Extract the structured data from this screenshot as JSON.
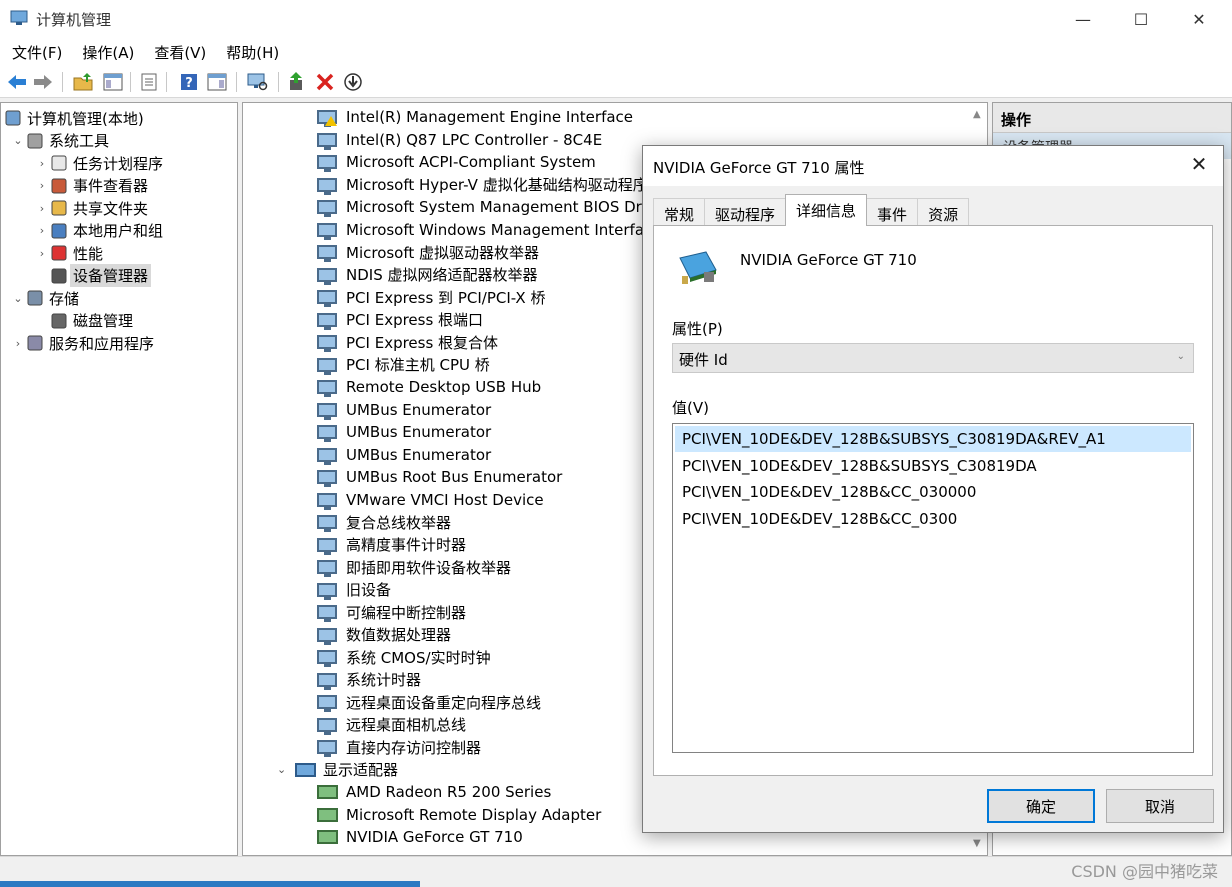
{
  "window": {
    "title": "计算机管理"
  },
  "menu": [
    "文件(F)",
    "操作(A)",
    "查看(V)",
    "帮助(H)"
  ],
  "tree": [
    {
      "label": "计算机管理(本地)",
      "level": 0,
      "expander": "",
      "icon": "computer-management-icon"
    },
    {
      "label": "系统工具",
      "level": 1,
      "expander": "⌄",
      "icon": "system-tools-icon"
    },
    {
      "label": "任务计划程序",
      "level": 2,
      "expander": "›",
      "icon": "clock-icon"
    },
    {
      "label": "事件查看器",
      "level": 2,
      "expander": "›",
      "icon": "event-viewer-icon"
    },
    {
      "label": "共享文件夹",
      "level": 2,
      "expander": "›",
      "icon": "shared-folder-icon"
    },
    {
      "label": "本地用户和组",
      "level": 2,
      "expander": "›",
      "icon": "users-icon"
    },
    {
      "label": "性能",
      "level": 2,
      "expander": "›",
      "icon": "performance-icon"
    },
    {
      "label": "设备管理器",
      "level": 2,
      "expander": "",
      "icon": "device-manager-icon",
      "selected": true
    },
    {
      "label": "存储",
      "level": 1,
      "expander": "⌄",
      "icon": "storage-icon"
    },
    {
      "label": "磁盘管理",
      "level": 2,
      "expander": "",
      "icon": "disk-icon"
    },
    {
      "label": "服务和应用程序",
      "level": 1,
      "expander": "›",
      "icon": "services-icon"
    }
  ],
  "devices": [
    {
      "label": "Intel(R) Management Engine Interface",
      "warn": true
    },
    {
      "label": "Intel(R) Q87 LPC Controller - 8C4E"
    },
    {
      "label": "Microsoft ACPI-Compliant System"
    },
    {
      "label": "Microsoft Hyper-V 虚拟化基础结构驱动程序"
    },
    {
      "label": "Microsoft System Management BIOS Driver"
    },
    {
      "label": "Microsoft Windows Management Interface f"
    },
    {
      "label": "Microsoft 虚拟驱动器枚举器"
    },
    {
      "label": "NDIS 虚拟网络适配器枚举器"
    },
    {
      "label": "PCI Express 到 PCI/PCI-X 桥"
    },
    {
      "label": "PCI Express 根端口"
    },
    {
      "label": "PCI Express 根复合体"
    },
    {
      "label": "PCI 标准主机 CPU 桥"
    },
    {
      "label": "Remote Desktop USB Hub"
    },
    {
      "label": "UMBus Enumerator"
    },
    {
      "label": "UMBus Enumerator"
    },
    {
      "label": "UMBus Enumerator"
    },
    {
      "label": "UMBus Root Bus Enumerator"
    },
    {
      "label": "VMware VMCI Host Device"
    },
    {
      "label": "复合总线枚举器"
    },
    {
      "label": "高精度事件计时器"
    },
    {
      "label": "即插即用软件设备枚举器"
    },
    {
      "label": "旧设备"
    },
    {
      "label": "可编程中断控制器"
    },
    {
      "label": "数值数据处理器"
    },
    {
      "label": "系统 CMOS/实时时钟"
    },
    {
      "label": "系统计时器"
    },
    {
      "label": "远程桌面设备重定向程序总线"
    },
    {
      "label": "远程桌面相机总线"
    },
    {
      "label": "直接内存访问控制器"
    }
  ],
  "display_category": {
    "label": "显示适配器",
    "expander": "⌄"
  },
  "display_devices": [
    "AMD Radeon R5 200 Series",
    "Microsoft Remote Display Adapter",
    "NVIDIA GeForce GT 710"
  ],
  "actions": {
    "header": "操作",
    "sub": "设备管理器"
  },
  "dialog": {
    "title": "NVIDIA GeForce GT 710 属性",
    "close": "✕",
    "tabs": [
      {
        "label": "常规"
      },
      {
        "label": "驱动程序"
      },
      {
        "label": "详细信息",
        "active": true
      },
      {
        "label": "事件"
      },
      {
        "label": "资源"
      }
    ],
    "device_name": "NVIDIA GeForce GT 710",
    "property_label": "属性(P)",
    "property_value": "硬件 Id",
    "value_label": "值(V)",
    "values": [
      "PCI\\VEN_10DE&DEV_128B&SUBSYS_C30819DA&REV_A1",
      "PCI\\VEN_10DE&DEV_128B&SUBSYS_C30819DA",
      "PCI\\VEN_10DE&DEV_128B&CC_030000",
      "PCI\\VEN_10DE&DEV_128B&CC_0300"
    ],
    "selected_value": 0,
    "ok": "确定",
    "cancel": "取消"
  },
  "watermark": "CSDN @园中猪吃菜",
  "colors": {
    "selection": "#cce8ff",
    "accent": "#0078d7"
  }
}
